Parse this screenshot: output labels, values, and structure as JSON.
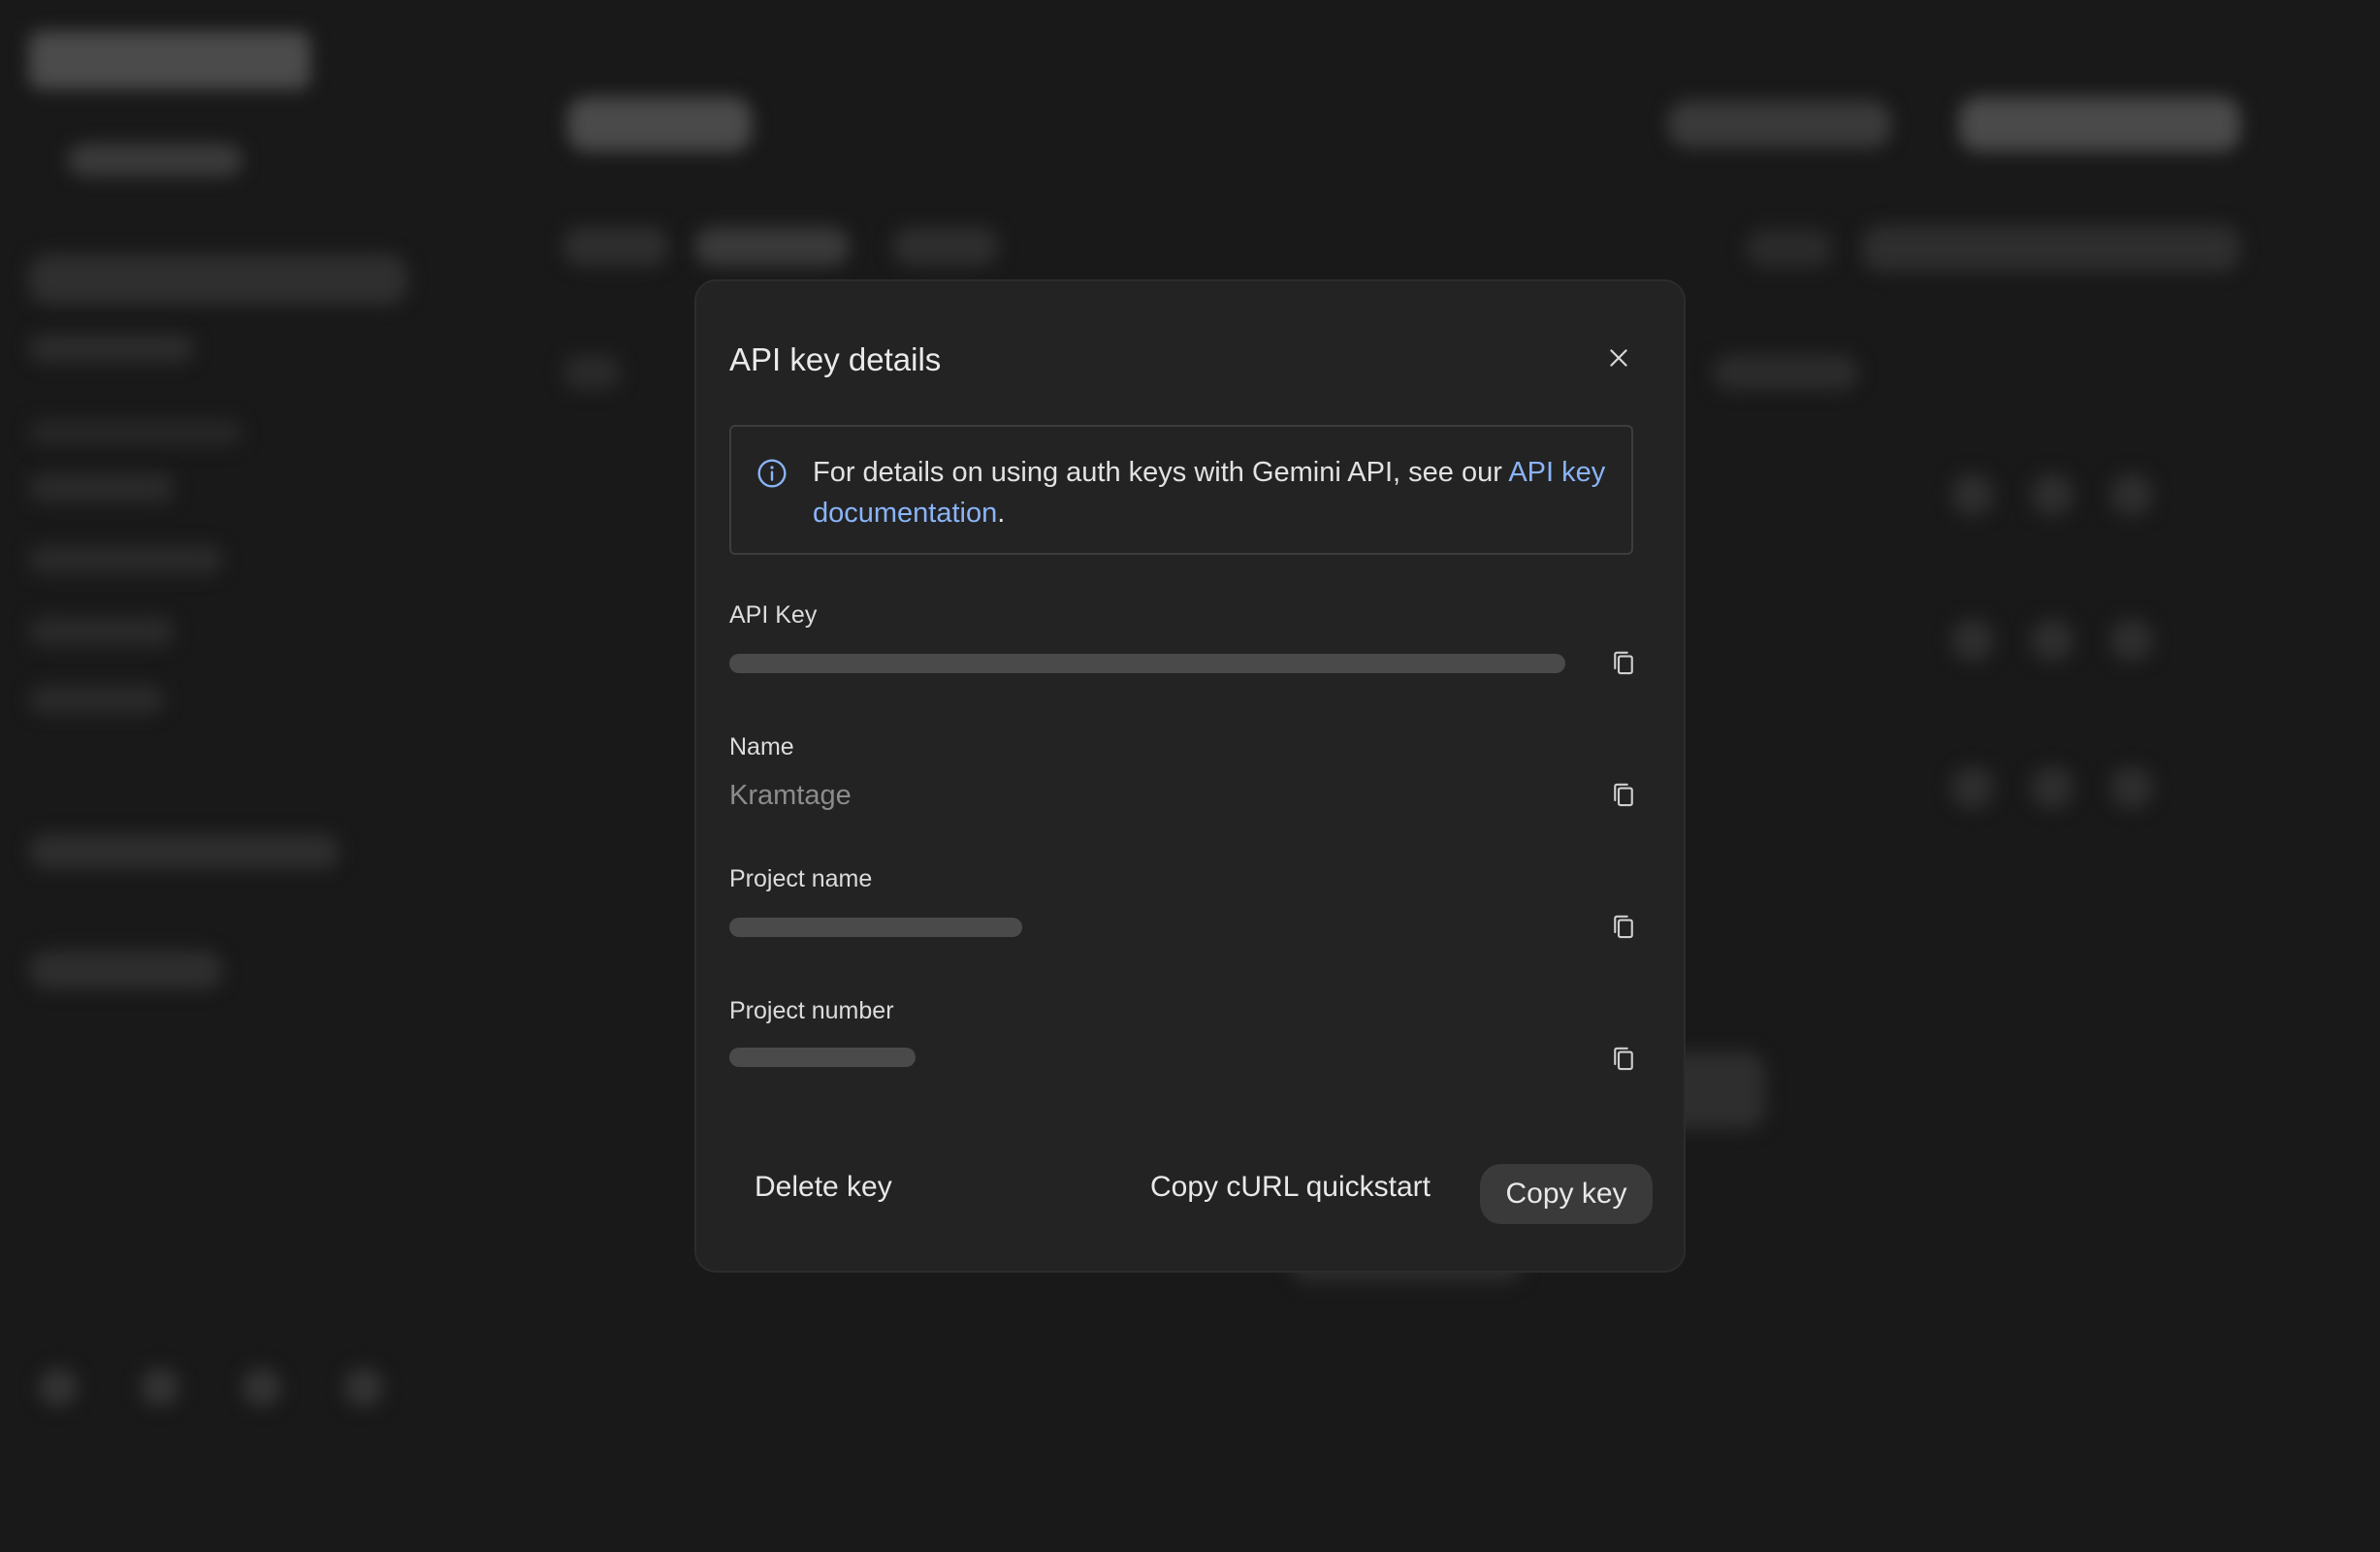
{
  "dialog": {
    "title": "API key details",
    "info": {
      "text": "For details on using auth keys with Gemini API, see our ",
      "link_text": "API key documentation",
      "suffix": "."
    },
    "fields": {
      "api_key": {
        "label": "API Key"
      },
      "name": {
        "label": "Name",
        "value": "Kramtage"
      },
      "project_name": {
        "label": "Project name"
      },
      "project_number": {
        "label": "Project number"
      }
    },
    "actions": {
      "delete": "Delete key",
      "copy_curl": "Copy cURL quickstart",
      "copy_key": "Copy key"
    }
  },
  "icons": {
    "close": "close-icon",
    "info": "info-icon",
    "copy": "copy-icon"
  },
  "colors": {
    "link": "#8ab4f8",
    "modal_bg": "#232323",
    "backdrop": "#191919"
  }
}
